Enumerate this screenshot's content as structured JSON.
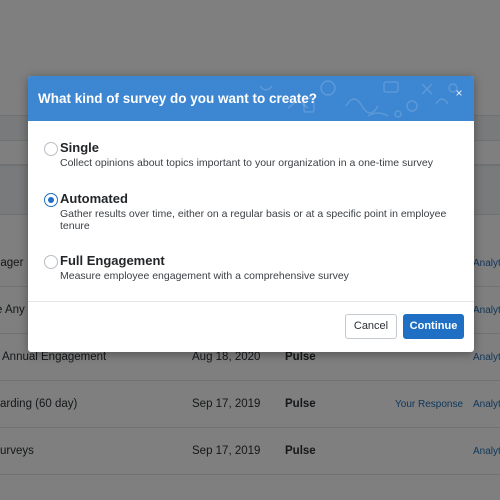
{
  "modal": {
    "title": "What kind of survey do you want to create?",
    "close_glyph": "×",
    "options": [
      {
        "title": "Single",
        "description": "Collect opinions about topics important to your organization in a one-time survey",
        "selected": false
      },
      {
        "title": "Automated",
        "description": "Gather results over time, either on a regular basis or at a specific point in employee tenure",
        "selected": true
      },
      {
        "title": "Full Engagement",
        "description": "Measure employee engagement with a comprehensive survey",
        "selected": false
      }
    ],
    "cancel_label": "Cancel",
    "continue_label": "Continue"
  },
  "background": {
    "rows": [
      {
        "name": "gager",
        "date": "",
        "type": "",
        "response": "",
        "analytics": "Analyti"
      },
      {
        "name": "e Any",
        "date": "",
        "type": "",
        "response": "",
        "analytics": "Analyti"
      },
      {
        "name": "Annual Engagement",
        "date": "Aug 18, 2020",
        "type": "Pulse",
        "response": "",
        "analytics": "Analyti"
      },
      {
        "name": "arding (60 day)",
        "date": "Sep 17, 2019",
        "type": "Pulse",
        "response": "Your Response",
        "analytics": "Analyti"
      },
      {
        "name": "urveys",
        "date": "Sep 17, 2019",
        "type": "Pulse",
        "response": "",
        "analytics": "Analyti"
      }
    ]
  },
  "colors": {
    "header_blue": "#3d86d1",
    "primary_button": "#1f6fc4",
    "link_blue": "#1f6fb7",
    "overlay": "rgba(0,0,0,0.5)"
  }
}
